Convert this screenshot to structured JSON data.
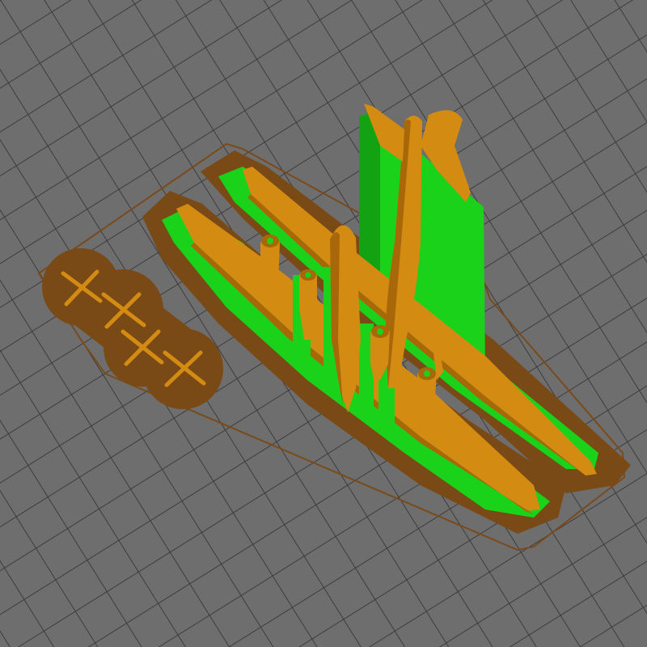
{
  "viewport": {
    "background_color": "#6e6e6e",
    "grid_line_color": "#3c3c3c"
  },
  "colors": {
    "model_orange": "#d48b12",
    "model_orange_dark": "#a8680a",
    "support_green": "#19d219",
    "support_green_dark": "#12a212",
    "brim_brown": "#7a4a16",
    "brim_brown_dark": "#5e3810",
    "skirt_outline": "#7a4a1a"
  },
  "scene": {
    "object_type": "airplane-model-parts",
    "propeller_count": 4,
    "engine_nacelle_count": 4,
    "has_supports": true,
    "has_brim": true,
    "has_skirt": true
  }
}
